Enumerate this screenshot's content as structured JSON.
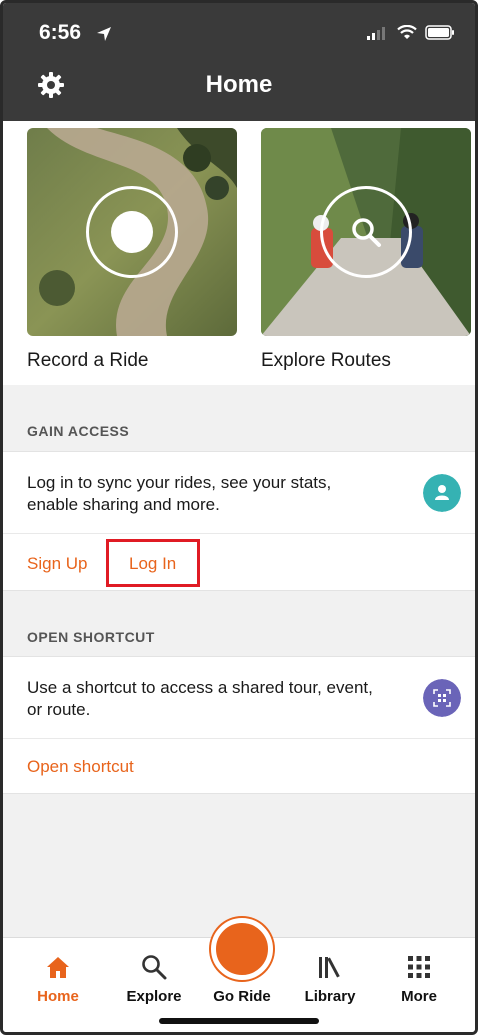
{
  "status_bar": {
    "time": "6:56"
  },
  "nav": {
    "title": "Home"
  },
  "tiles": [
    {
      "label": "Record a Ride"
    },
    {
      "label": "Explore Routes"
    }
  ],
  "gain_access": {
    "header": "GAIN ACCESS",
    "text": "Log in to sync your rides, see your stats, enable sharing and more.",
    "sign_up": "Sign Up",
    "log_in": "Log In"
  },
  "open_shortcut": {
    "header": "OPEN SHORTCUT",
    "text": "Use a shortcut to access a shared tour, event, or route.",
    "link": "Open shortcut"
  },
  "tabs": [
    {
      "label": "Home",
      "icon": "home-icon",
      "active": true
    },
    {
      "label": "Explore",
      "icon": "search-icon",
      "active": false
    },
    {
      "label": "Go Ride",
      "icon": "record-icon",
      "active": false
    },
    {
      "label": "Library",
      "icon": "library-icon",
      "active": false
    },
    {
      "label": "More",
      "icon": "grid-icon",
      "active": false
    }
  ],
  "colors": {
    "accent": "#e8641c",
    "topbar": "#3a3a3a",
    "teal": "#35b2b3",
    "purple": "#6a64b8",
    "highlight": "#e01b24"
  }
}
